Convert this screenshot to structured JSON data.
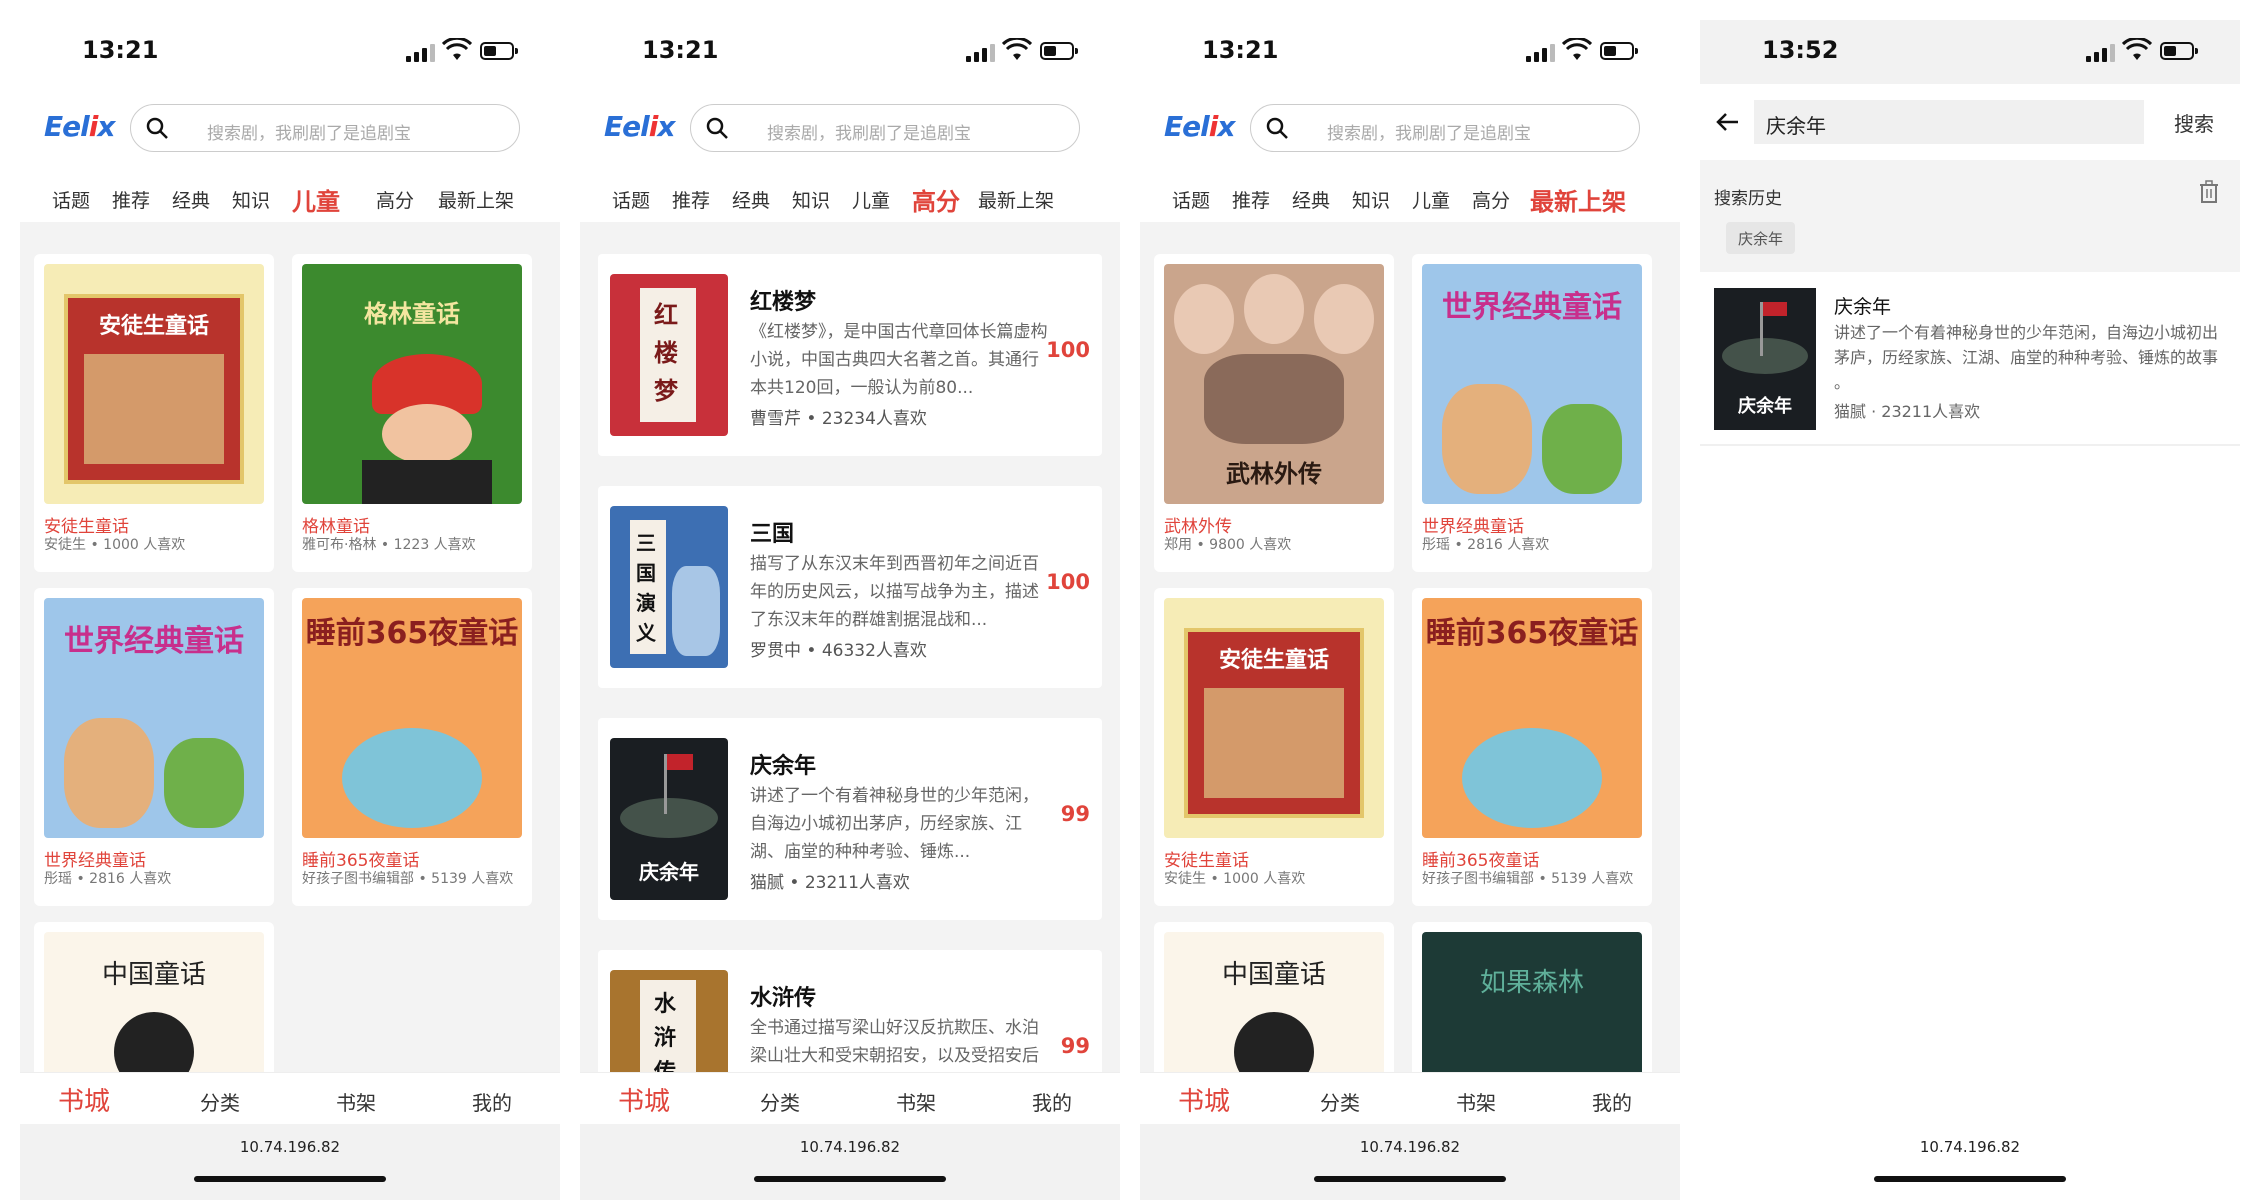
{
  "statusbar": {
    "time_a": "13:21",
    "time_b": "13:52"
  },
  "search": {
    "placeholder": "搜索剧，我刷剧了是追剧宝"
  },
  "tabs": [
    "话题",
    "推荐",
    "经典",
    "知识",
    "儿童",
    "高分",
    "最新上架"
  ],
  "nav": [
    "书城",
    "分类",
    "书架",
    "我的"
  ],
  "url": "10.74.196.82",
  "colors": {
    "accent": "#e0443b",
    "logo_blue": "#2a6fd6"
  },
  "screen1": {
    "active_tab": "儿童",
    "books": [
      {
        "title": "安徒生童话",
        "sub": "安徒生 • 1000 人喜欢",
        "cover": "安徒生童话"
      },
      {
        "title": "格林童话",
        "sub": "雅可布·格林 • 1223 人喜欢",
        "cover": "格林童话"
      },
      {
        "title": "世界经典童话",
        "sub": "彤瑶 • 2816 人喜欢",
        "cover": "世界经典童话"
      },
      {
        "title": "睡前365夜童话",
        "sub": "好孩子图书编辑部 • 5139 人喜欢",
        "cover": "睡前365夜童话"
      },
      {
        "title": "",
        "sub": "",
        "cover": "中国童话"
      }
    ]
  },
  "screen2": {
    "active_tab": "高分",
    "books": [
      {
        "title": "红楼梦",
        "desc": "《红楼梦》，是中国古代章回体长篇虚构小说，中国古典四大名著之首。其通行本共120回，一般认为前80...",
        "author": "曹雪芹 • 23234人喜欢",
        "score": "100",
        "cover": "红楼梦"
      },
      {
        "title": "三国",
        "desc": "描写了从东汉末年到西晋初年之间近百年的历史风云，以描写战争为主，描述了东汉末年的群雄割据混战和...",
        "author": "罗贯中 • 46332人喜欢",
        "score": "100",
        "cover": "三国演义"
      },
      {
        "title": "庆余年",
        "desc": "讲述了一个有着神秘身世的少年范闲，自海边小城初出茅庐，历经家族、江湖、庙堂的种种考验、锤炼...",
        "author": "猫腻 • 23211人喜欢",
        "score": "99",
        "cover": "庆余年"
      },
      {
        "title": "水浒传",
        "desc": "全书通过描写梁山好汉反抗欺压、水泊梁山壮大和受宋朝招安，以及受招安后",
        "author": "",
        "score": "99",
        "cover": "水浒传"
      }
    ]
  },
  "screen3": {
    "active_tab": "最新上架",
    "books": [
      {
        "title": "武林外传",
        "sub": "郑用 • 9800 人喜欢",
        "cover": "武林外传"
      },
      {
        "title": "世界经典童话",
        "sub": "彤瑶 • 2816 人喜欢",
        "cover": "世界经典童话"
      },
      {
        "title": "安徒生童话",
        "sub": "安徒生 • 1000 人喜欢",
        "cover": "安徒生童话"
      },
      {
        "title": "睡前365夜童话",
        "sub": "好孩子图书编辑部 • 5139 人喜欢",
        "cover": "睡前365夜童话"
      },
      {
        "title": "",
        "sub": "",
        "cover": "中国童话"
      },
      {
        "title": "",
        "sub": "",
        "cover": "如果森林"
      }
    ]
  },
  "screen4": {
    "query": "庆余年",
    "search_button": "搜索",
    "history_label": "搜索历史",
    "history": [
      "庆余年"
    ],
    "result": {
      "title": "庆余年",
      "desc": "讲述了一个有着神秘身世的少年范闲，自海边小城初出茅庐，历经家族、江湖、庙堂的种种考验、锤炼的故事 。",
      "author": "猫腻 · 23211人喜欢",
      "cover": "庆余年"
    }
  }
}
